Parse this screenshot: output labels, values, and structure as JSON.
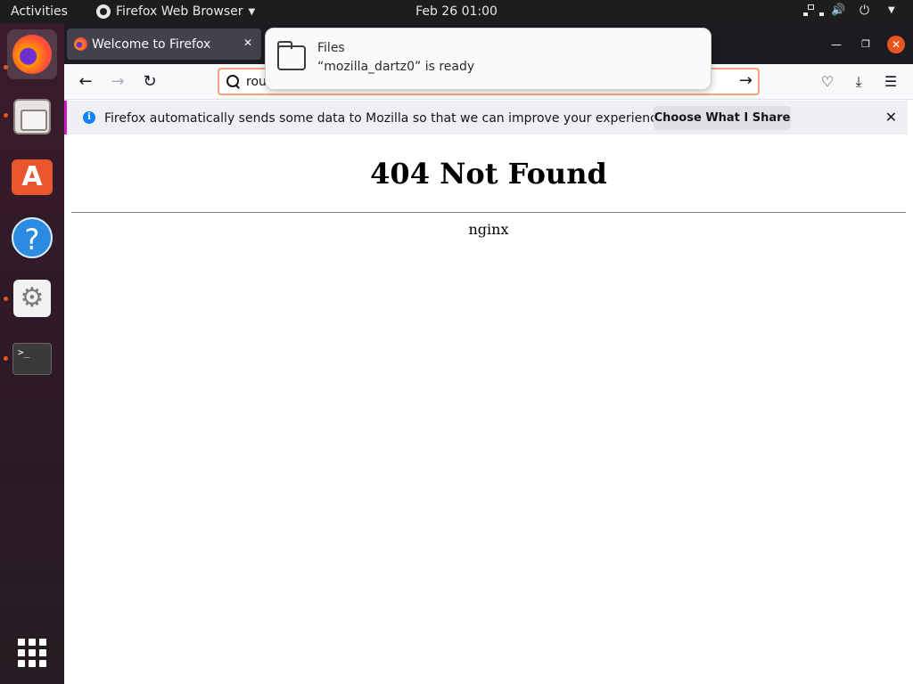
{
  "topbar": {
    "activities": "Activities",
    "app_name": "Firefox Web Browser",
    "clock": "Feb 26  01:00"
  },
  "browser": {
    "tab": {
      "title": "Welcome to Firefox"
    },
    "urlbar": {
      "value": "rou"
    },
    "notice": {
      "message": "Firefox automatically sends some data to Mozilla so that we can improve your experience.",
      "button": "Choose What I Share"
    },
    "page": {
      "heading": "404 Not Found",
      "server": "nginx"
    }
  },
  "toast": {
    "title": "Files",
    "body": "“mozilla_dartz0” is ready"
  },
  "colors": {
    "dock_bg": "#2c1a25",
    "accent": "#e95420",
    "tabstrip": "#1c1b22",
    "notice_border": "#c91bcb"
  }
}
